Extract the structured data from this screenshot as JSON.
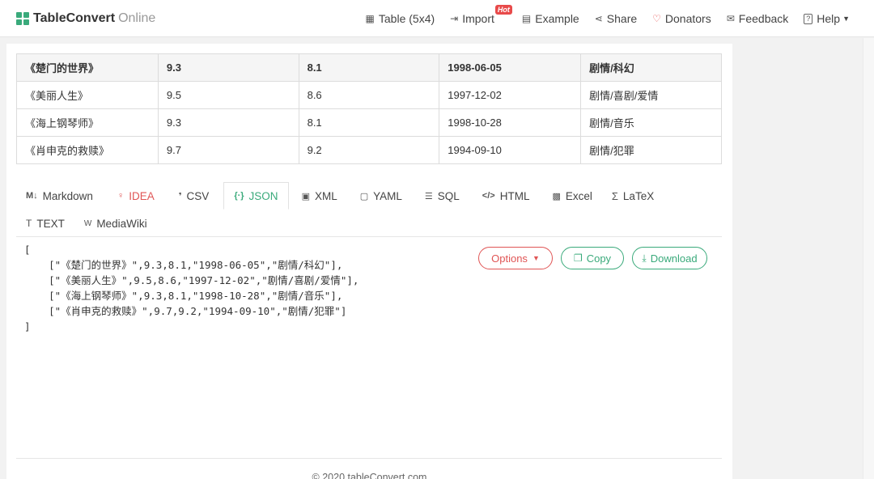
{
  "brand": {
    "name": "TableConvert",
    "suffix": "Online"
  },
  "nav": [
    {
      "icon": "table-icon",
      "glyph": "▦",
      "label": "Table (5x4)"
    },
    {
      "icon": "import-icon",
      "glyph": "⇥",
      "label": "Import",
      "badge": "Hot"
    },
    {
      "icon": "example-icon",
      "glyph": "▤",
      "label": "Example"
    },
    {
      "icon": "share-icon",
      "glyph": "⋖",
      "label": "Share"
    },
    {
      "icon": "heart-icon",
      "glyph": "♡",
      "label": "Donators"
    },
    {
      "icon": "mail-icon",
      "glyph": "✉",
      "label": "Feedback"
    },
    {
      "icon": "help-icon",
      "glyph": "?",
      "label": "Help"
    }
  ],
  "table": {
    "rows": [
      [
        "《楚门的世界》",
        "9.3",
        "8.1",
        "1998-06-05",
        "剧情/科幻"
      ],
      [
        "《美丽人生》",
        "9.5",
        "8.6",
        "1997-12-02",
        "剧情/喜剧/爱情"
      ],
      [
        "《海上钢琴师》",
        "9.3",
        "8.1",
        "1998-10-28",
        "剧情/音乐"
      ],
      [
        "《肖申克的救赎》",
        "9.7",
        "9.2",
        "1994-09-10",
        "剧情/犯罪"
      ]
    ]
  },
  "tabs": [
    {
      "icon": "markdown-icon",
      "glyph": "M↓",
      "label": "Markdown"
    },
    {
      "icon": "lightbulb-icon",
      "glyph": "♀",
      "label": "IDEA"
    },
    {
      "icon": "csv-icon",
      "glyph": "❜",
      "label": "CSV"
    },
    {
      "icon": "json-icon",
      "glyph": "{·}",
      "label": "JSON"
    },
    {
      "icon": "xml-icon",
      "glyph": "▣",
      "label": "XML"
    },
    {
      "icon": "yaml-icon",
      "glyph": "▢",
      "label": "YAML"
    },
    {
      "icon": "database-icon",
      "glyph": "☰",
      "label": "SQL"
    },
    {
      "icon": "code-icon",
      "glyph": "</>",
      "label": "HTML"
    },
    {
      "icon": "excel-icon",
      "glyph": "▩",
      "label": "Excel"
    },
    {
      "icon": "sigma-icon",
      "glyph": "Σ",
      "label": "LaTeX"
    },
    {
      "icon": "text-icon",
      "glyph": "T",
      "label": "TEXT"
    },
    {
      "icon": "wiki-icon",
      "glyph": "W",
      "label": "MediaWiki"
    }
  ],
  "active_tab": "JSON",
  "output": "[\n    [\"《楚门的世界》\",9.3,8.1,\"1998-06-05\",\"剧情/科幻\"],\n    [\"《美丽人生》\",9.5,8.6,\"1997-12-02\",\"剧情/喜剧/爱情\"],\n    [\"《海上钢琴师》\",9.3,8.1,\"1998-10-28\",\"剧情/音乐\"],\n    [\"《肖申克的救赎》\",9.7,9.2,\"1994-09-10\",\"剧情/犯罪\"]\n]",
  "buttons": {
    "options": "Options",
    "copy": "Copy",
    "download": "Download"
  },
  "footer": "© 2020 tableConvert.com",
  "colors": {
    "accent": "#3aaa7b",
    "danger": "#e05555"
  }
}
